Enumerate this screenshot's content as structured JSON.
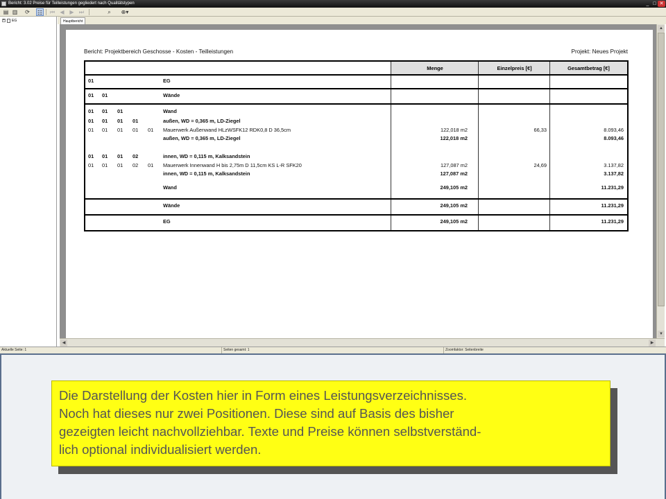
{
  "window": {
    "title": "Bericht: 3.02 Preise für Teilleistungen gegliedert nach Qualitätstypen",
    "minimize_glyph": "_",
    "maximize_glyph": "□",
    "close_glyph": "✕"
  },
  "toolbar": {
    "icons": [
      "print-icon",
      "export-icon",
      "refresh-icon",
      "tree-view-icon",
      "first-page-icon",
      "previous-page-icon",
      "next-page-icon",
      "last-page-icon",
      "find-icon",
      "zoom-icon"
    ],
    "glyphs": {
      "print": "▤",
      "export": "▥",
      "refresh": "⟳",
      "tree": "☷",
      "first": "⏮",
      "prev": "◀",
      "next": "▶",
      "last": "⏭",
      "find": "⌕",
      "zoom": "⊕▾"
    }
  },
  "tree": {
    "expander": "+",
    "root_label": "EG"
  },
  "tab": {
    "label": "Hauptbericht"
  },
  "report": {
    "title": "Bericht: Projektbereich Geschosse  - Kosten - Teilleistungen",
    "project": "Projekt: Neues Projekt",
    "columns": {
      "menge": "Menge",
      "einzelpreis": "Einzelpreis [€]",
      "gesamtbetrag": "Gesamtbetrag [€]"
    },
    "rows": {
      "eg": {
        "c1": "01",
        "label": "EG"
      },
      "waende": {
        "c1": "01",
        "c2": "01",
        "label": "Wände"
      },
      "wand": {
        "c1": "01",
        "c2": "01",
        "c3": "01",
        "label": "Wand"
      },
      "aussen": {
        "c1": "01",
        "c2": "01",
        "c3": "01",
        "c4": "01",
        "label": "außen, WD = 0,365 m, LD-Ziegel"
      },
      "item1": {
        "c1": "01",
        "c2": "01",
        "c3": "01",
        "c4": "01",
        "c5": "01",
        "label": "Mauerwerk Außenwand HLzWSFK12 RDK0,8 D 36,5cm",
        "menge": "122,018 m2",
        "einzelpreis": "66,33",
        "gesamt": "8.093,46"
      },
      "aussen_sum": {
        "label": "außen, WD = 0,365 m, LD-Ziegel",
        "menge": "122,018 m2",
        "gesamt": "8.093,46"
      },
      "innen": {
        "c1": "01",
        "c2": "01",
        "c3": "01",
        "c4": "02",
        "label": "innen, WD = 0,115 m, Kalksandstein"
      },
      "item2": {
        "c1": "01",
        "c2": "01",
        "c3": "01",
        "c4": "02",
        "c5": "01",
        "label": "Mauerwerk Innenwand H bis 2,75m D 11,5cm KS L-R SFK20",
        "menge": "127,087 m2",
        "einzelpreis": "24,69",
        "gesamt": "3.137,82"
      },
      "innen_sum": {
        "label": "innen, WD = 0,115 m, Kalksandstein",
        "menge": "127,087 m2",
        "gesamt": "3.137,82"
      },
      "wand_sum": {
        "label": "Wand",
        "menge": "249,105 m2",
        "gesamt": "11.231,29"
      },
      "waende_sum": {
        "label": "Wände",
        "menge": "249,105 m2",
        "gesamt": "11.231,29"
      },
      "eg_sum": {
        "label": "EG",
        "menge": "249,105 m2",
        "gesamt": "11.231,29"
      }
    }
  },
  "statusbar": {
    "current_page": "Aktuelle Seite: 1",
    "total_pages": "Seiten gesamt: 1",
    "zoom": "Zoomfaktor: Seitenbreite"
  },
  "callout": {
    "line1": "Die Darstellung der Kosten hier in Form eines Leistungsverzeichnisses.",
    "line2": "Noch hat dieses nur zwei Positionen. Diese sind auf Basis des bisher",
    "line3": "gezeigten leicht nachvollziehbar. Texte und Preise können selbstverständ-",
    "line4": "lich optional individualisiert  werden."
  },
  "colors": {
    "callout_bg": "#ffff14",
    "callout_text": "#555555",
    "header_fill": "#e0e0e0",
    "viewport_bg": "#8f8f8f"
  }
}
